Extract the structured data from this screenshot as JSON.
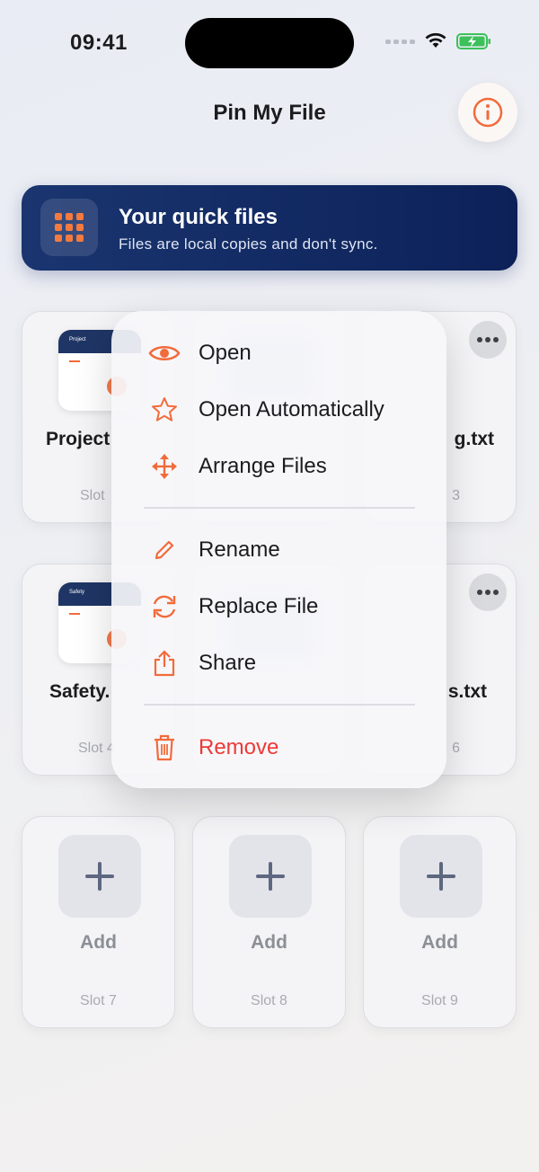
{
  "status_bar": {
    "time": "09:41"
  },
  "header": {
    "title": "Pin My File"
  },
  "banner": {
    "title": "Your quick files",
    "subtitle": "Files are local copies and don't sync."
  },
  "slots": [
    {
      "name": "Project",
      "label": "Slot",
      "thumb_title": "Project"
    },
    {
      "name": "",
      "label": ""
    },
    {
      "name": "g.txt",
      "label": "3"
    },
    {
      "name": "Safety.",
      "label": "Slot 4",
      "thumb_title": "Safety"
    },
    {
      "name": "",
      "label": ""
    },
    {
      "name": "s.txt",
      "label": "6"
    },
    {
      "add_label": "Add",
      "label": "Slot 7"
    },
    {
      "add_label": "Add",
      "label": "Slot 8"
    },
    {
      "add_label": "Add",
      "label": "Slot 9"
    }
  ],
  "context_menu": {
    "items": [
      {
        "label": "Open",
        "icon": "eye-icon"
      },
      {
        "label": "Open Automatically",
        "icon": "star-icon"
      },
      {
        "label": "Arrange Files",
        "icon": "move-arrows-icon"
      },
      {
        "label": "Rename",
        "icon": "pencil-icon"
      },
      {
        "label": "Replace File",
        "icon": "replace-icon"
      },
      {
        "label": "Share",
        "icon": "share-icon"
      },
      {
        "label": "Remove",
        "icon": "trash-icon"
      }
    ]
  },
  "colors": {
    "accent": "#F26B3A",
    "banner": "#0C2158",
    "destructive": "#EC3A36"
  }
}
